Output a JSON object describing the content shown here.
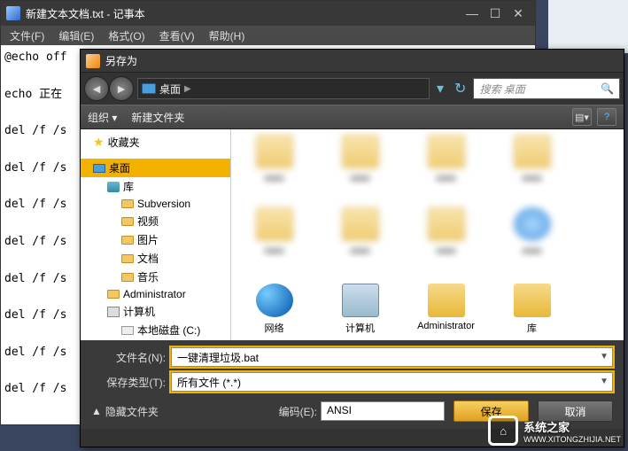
{
  "notepad": {
    "title": "新建文本文档.txt - 记事本",
    "menus": {
      "file": "文件(F)",
      "edit": "编辑(E)",
      "format": "格式(O)",
      "view": "查看(V)",
      "help": "帮助(H)"
    },
    "content": "@echo off\n\necho 正在\n\ndel /f /s\n\ndel /f /s\n\ndel /f /s\n\ndel /f /s\n\ndel /f /s\n\ndel /f /s\n\ndel /f /s\n\ndel /f /s"
  },
  "saveas": {
    "title": "另存为",
    "crumb": "桌面",
    "search_placeholder": "搜索 桌面",
    "toolbar": {
      "organize": "组织 ▾",
      "newfolder": "新建文件夹"
    },
    "tree": {
      "favorites": "收藏夹",
      "desktop": "桌面",
      "libraries": "库",
      "subversion": "Subversion",
      "videos": "视频",
      "pictures": "图片",
      "documents": "文档",
      "music": "音乐",
      "admin": "Administrator",
      "computer": "计算机",
      "localdisk": "本地磁盘 (C:)"
    },
    "files": {
      "network": "网络",
      "computer": "计算机",
      "admin": "Administrator",
      "libraries": "库"
    },
    "form": {
      "filename_label": "文件名(N):",
      "filename_value": "一键清理垃圾.bat",
      "filetype_label": "保存类型(T):",
      "filetype_value": "所有文件 (*.*)",
      "hide_folders": "隐藏文件夹",
      "encoding_label": "编码(E):",
      "encoding_value": "ANSI",
      "save": "保存",
      "cancel": "取消"
    }
  },
  "watermark": {
    "text": "系统之家",
    "url": "WWW.XITONGZHIJIA.NET"
  }
}
